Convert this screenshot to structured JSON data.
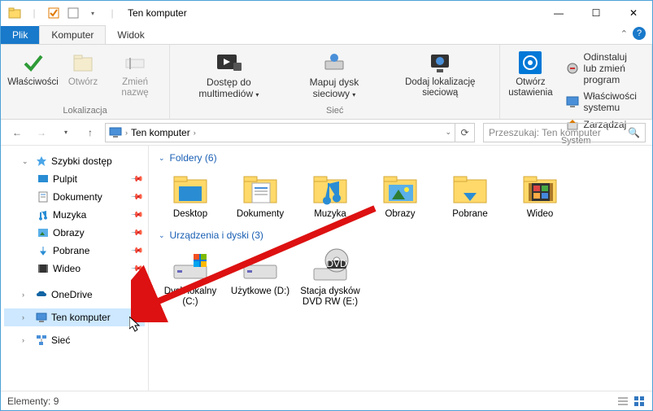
{
  "window": {
    "title": "Ten komputer",
    "controls": {
      "min": "—",
      "max": "☐",
      "close": "✕"
    }
  },
  "tabs": {
    "file": "Plik",
    "computer": "Komputer",
    "view": "Widok"
  },
  "ribbon": {
    "groups": {
      "location": {
        "label": "Lokalizacja",
        "properties": "Właściwości",
        "open": "Otwórz",
        "rename": "Zmień nazwę"
      },
      "network": {
        "label": "Sieć",
        "media": "Dostęp do multimediów",
        "map": "Mapuj dysk sieciowy",
        "add": "Dodaj lokalizację sieciową"
      },
      "system": {
        "label": "System",
        "settings": "Otwórz ustawienia",
        "uninstall": "Odinstaluj lub zmień program",
        "sysprops": "Właściwości systemu",
        "manage": "Zarządzaj"
      }
    }
  },
  "address": {
    "root": "Ten komputer"
  },
  "search": {
    "placeholder": "Przeszukaj: Ten komputer"
  },
  "nav": {
    "quick": "Szybki dostęp",
    "quick_items": [
      {
        "label": "Pulpit",
        "icon": "desktop"
      },
      {
        "label": "Dokumenty",
        "icon": "documents"
      },
      {
        "label": "Muzyka",
        "icon": "music"
      },
      {
        "label": "Obrazy",
        "icon": "pictures"
      },
      {
        "label": "Pobrane",
        "icon": "downloads"
      },
      {
        "label": "Wideo",
        "icon": "video"
      }
    ],
    "onedrive": "OneDrive",
    "thispc": "Ten komputer",
    "network": "Sieć"
  },
  "main": {
    "folders_header": "Foldery (6)",
    "folders": [
      {
        "label": "Desktop",
        "icon": "desktop"
      },
      {
        "label": "Dokumenty",
        "icon": "documents"
      },
      {
        "label": "Muzyka",
        "icon": "music"
      },
      {
        "label": "Obrazy",
        "icon": "pictures"
      },
      {
        "label": "Pobrane",
        "icon": "downloads"
      },
      {
        "label": "Wideo",
        "icon": "video"
      }
    ],
    "devices_header": "Urządzenia i dyski (3)",
    "devices": [
      {
        "label": "Dysk lokalny (C:)",
        "icon": "drive"
      },
      {
        "label": "Użytkowe (D:)",
        "icon": "drive"
      },
      {
        "label": "Stacja dysków DVD RW (E:)",
        "icon": "dvd"
      }
    ]
  },
  "status": {
    "count_label": "Elementy: 9"
  }
}
